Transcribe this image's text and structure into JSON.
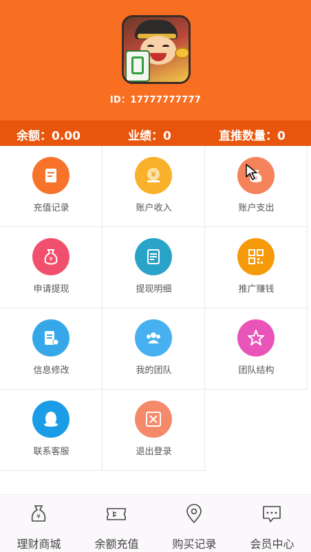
{
  "header": {
    "user_id": "ID：17777777777"
  },
  "stats": {
    "balance": "余额：0.00",
    "performance": "业绩：0",
    "direct_count": "直推数量：0"
  },
  "grid": {
    "items": [
      {
        "label": "充值记录",
        "icon": "recharge-record-icon",
        "color": "#f7722a"
      },
      {
        "label": "账户收入",
        "icon": "account-income-icon",
        "color": "#f9b02a"
      },
      {
        "label": "账户支出",
        "icon": "account-expense-icon",
        "color": "#f4835c"
      },
      {
        "label": "申请提现",
        "icon": "money-bag-icon",
        "color": "#f0506e"
      },
      {
        "label": "提现明细",
        "icon": "withdraw-detail-icon",
        "color": "#2aa3c9"
      },
      {
        "label": "推广赚钱",
        "icon": "qr-code-icon",
        "color": "#f79a0a"
      },
      {
        "label": "信息修改",
        "icon": "edit-info-icon",
        "color": "#36a8e9"
      },
      {
        "label": "我的团队",
        "icon": "team-icon",
        "color": "#47b0f0"
      },
      {
        "label": "团队结构",
        "icon": "star-icon",
        "color": "#e854b8"
      },
      {
        "label": "联系客服",
        "icon": "customer-service-icon",
        "color": "#1a9ce6"
      },
      {
        "label": "退出登录",
        "icon": "logout-icon",
        "color": "#f58a6a"
      }
    ]
  },
  "tabbar": {
    "items": [
      {
        "label": "理财商城",
        "icon": "money-bag-outline-icon"
      },
      {
        "label": "余额充值",
        "icon": "ticket-icon"
      },
      {
        "label": "购买记录",
        "icon": "location-pin-icon"
      },
      {
        "label": "会员中心",
        "icon": "chat-bubble-icon"
      }
    ]
  }
}
